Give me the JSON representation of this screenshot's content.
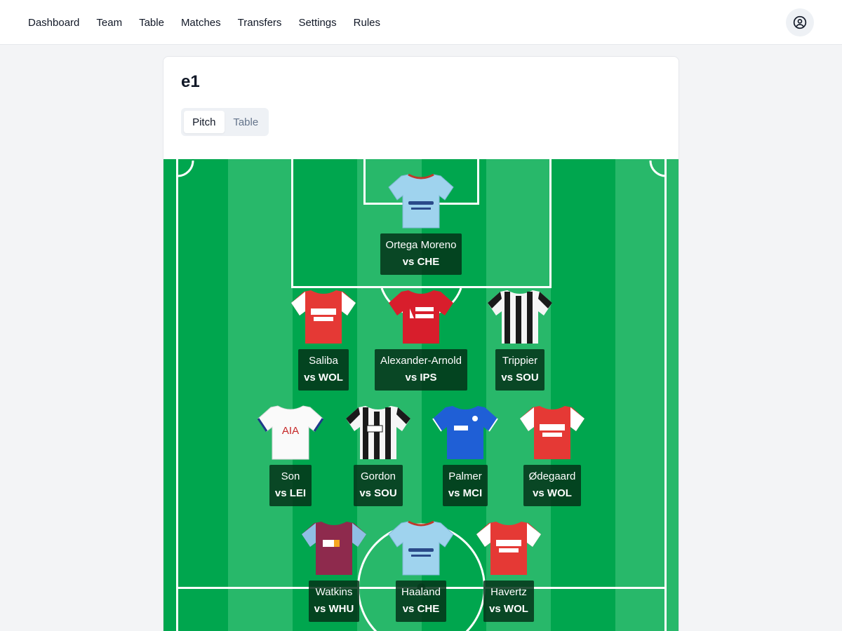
{
  "nav": {
    "links": [
      "Dashboard",
      "Team",
      "Table",
      "Matches",
      "Transfers",
      "Settings",
      "Rules"
    ]
  },
  "account_icon": "user-circle-icon",
  "card": {
    "title": "e1",
    "view_tabs": [
      {
        "label": "Pitch",
        "active": true
      },
      {
        "label": "Table",
        "active": false
      }
    ]
  },
  "colors": {
    "pitch_dark": "#00a64e",
    "pitch_light": "#28b86a",
    "label_bg": "#043219"
  },
  "players": [
    {
      "name": "Ortega Moreno",
      "fixture": "vs CHE",
      "shirt": "sky-blue"
    },
    {
      "name": "Saliba",
      "fixture": "vs WOL",
      "shirt": "red-white-sleeves"
    },
    {
      "name": "Alexander-Arnold",
      "fixture": "vs IPS",
      "shirt": "red"
    },
    {
      "name": "Trippier",
      "fixture": "vs SOU",
      "shirt": "black-white-stripes"
    },
    {
      "name": "Son",
      "fixture": "vs LEI",
      "shirt": "white"
    },
    {
      "name": "Gordon",
      "fixture": "vs SOU",
      "shirt": "black-white-stripes"
    },
    {
      "name": "Palmer",
      "fixture": "vs MCI",
      "shirt": "blue"
    },
    {
      "name": "Ødegaard",
      "fixture": "vs WOL",
      "shirt": "red-white-sleeves"
    },
    {
      "name": "Watkins",
      "fixture": "vs WHU",
      "shirt": "claret-blue"
    },
    {
      "name": "Haaland",
      "fixture": "vs CHE",
      "shirt": "sky-blue"
    },
    {
      "name": "Havertz",
      "fixture": "vs WOL",
      "shirt": "red-white-sleeves"
    }
  ],
  "shirt_text": {
    "son_sponsor": "AIA"
  }
}
